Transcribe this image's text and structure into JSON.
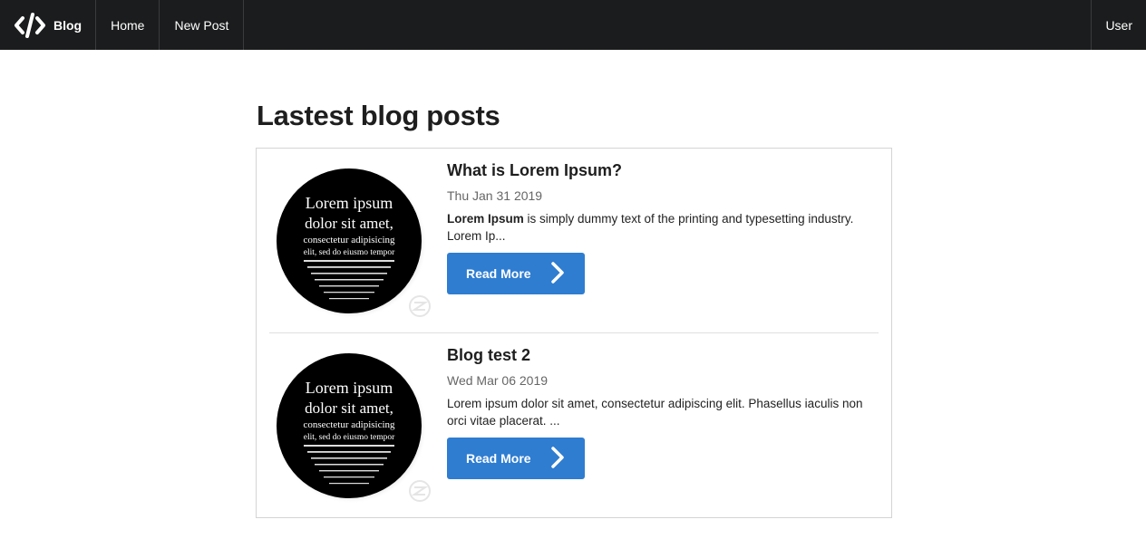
{
  "navbar": {
    "brand_label": "Blog",
    "brand_icon": "code-icon",
    "items": [
      {
        "label": "Home"
      },
      {
        "label": "New Post"
      }
    ],
    "user_label": "User"
  },
  "main": {
    "title": "Lastest blog posts",
    "posts": [
      {
        "title": "What is Lorem Ipsum?",
        "date": "Thu Jan 31 2019",
        "excerpt_bold": "Lorem Ipsum",
        "excerpt_rest": " is simply dummy text of the printing and typesetting industry. Lorem Ip...",
        "button_label": "Read More",
        "image_text": [
          "Lorem ipsum",
          "dolor sit amet,",
          "consectetur adipisicing",
          "elit, sed do eiusmo tempor"
        ]
      },
      {
        "title": "Blog test 2",
        "date": "Wed Mar 06 2019",
        "excerpt_bold": "",
        "excerpt_rest": "Lorem ipsum dolor sit amet, consectetur adipiscing elit. Phasellus iaculis non orci vitae placerat. ...",
        "button_label": "Read More",
        "image_text": [
          "Lorem ipsum",
          "dolor sit amet,",
          "consectetur adipisicing",
          "elit, sed do eiusmo tempor"
        ]
      }
    ]
  },
  "colors": {
    "navbar_bg": "#1b1c1d",
    "button_bg": "#2e7dd1"
  }
}
